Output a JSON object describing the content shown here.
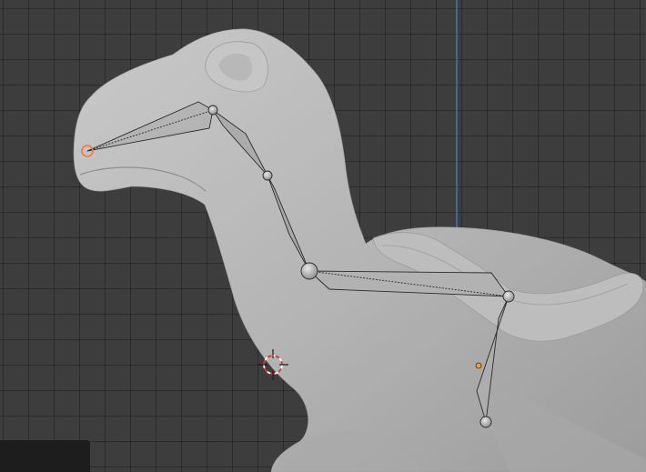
{
  "viewport": {
    "background_color": "#3d3d3d",
    "axis_line_color": "#4f7fd1",
    "mesh_color": "#b9b9b9",
    "bone_color": "#b0b0b0",
    "selection_color": "#f07a36",
    "origin_color": "#ff9a2a"
  },
  "scene": {
    "object": "creature-mesh",
    "armature_bones": 5
  }
}
